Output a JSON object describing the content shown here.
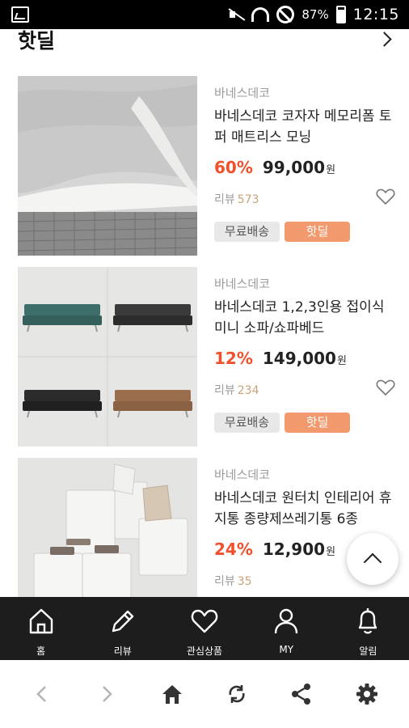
{
  "status_bar": {
    "battery_percent": "87%",
    "time": "12:15"
  },
  "section": {
    "title": "핫딜"
  },
  "products": [
    {
      "brand": "바네스데코",
      "name": "바네스데코 코자자 메모리폼 토퍼 매트리스 모닝",
      "discount": "60%",
      "price": "99,000",
      "currency": "원",
      "review_label": "리뷰",
      "review_count": "573",
      "badge_free": "무료배송",
      "badge_hot": "핫딜"
    },
    {
      "brand": "바네스데코",
      "name": "바네스데코 1,2,3인용 접이식 미니 소파/쇼파베드",
      "discount": "12%",
      "price": "149,000",
      "currency": "원",
      "review_label": "리뷰",
      "review_count": "234",
      "badge_free": "무료배송",
      "badge_hot": "핫딜"
    },
    {
      "brand": "바네스데코",
      "name": "바네스데코 원터치 인테리어 휴지통 종량제쓰레기통 6종",
      "discount": "24%",
      "price": "12,900",
      "currency": "원",
      "review_label": "리뷰",
      "review_count": "35"
    }
  ],
  "bottom_nav": [
    {
      "label": "홈",
      "icon": "home-icon"
    },
    {
      "label": "리뷰",
      "icon": "pencil-icon"
    },
    {
      "label": "관심상품",
      "icon": "heart-icon"
    },
    {
      "label": "MY",
      "icon": "person-icon"
    },
    {
      "label": "알림",
      "icon": "bell-icon"
    }
  ],
  "browser_toolbar": [
    "back-icon",
    "forward-icon",
    "home-icon",
    "refresh-icon",
    "share-icon",
    "settings-icon"
  ],
  "colors": {
    "discount": "#f0502b",
    "hot_badge": "#f29a6e",
    "nav_background": "#1d1d1d",
    "review_count": "#c9a37a"
  }
}
